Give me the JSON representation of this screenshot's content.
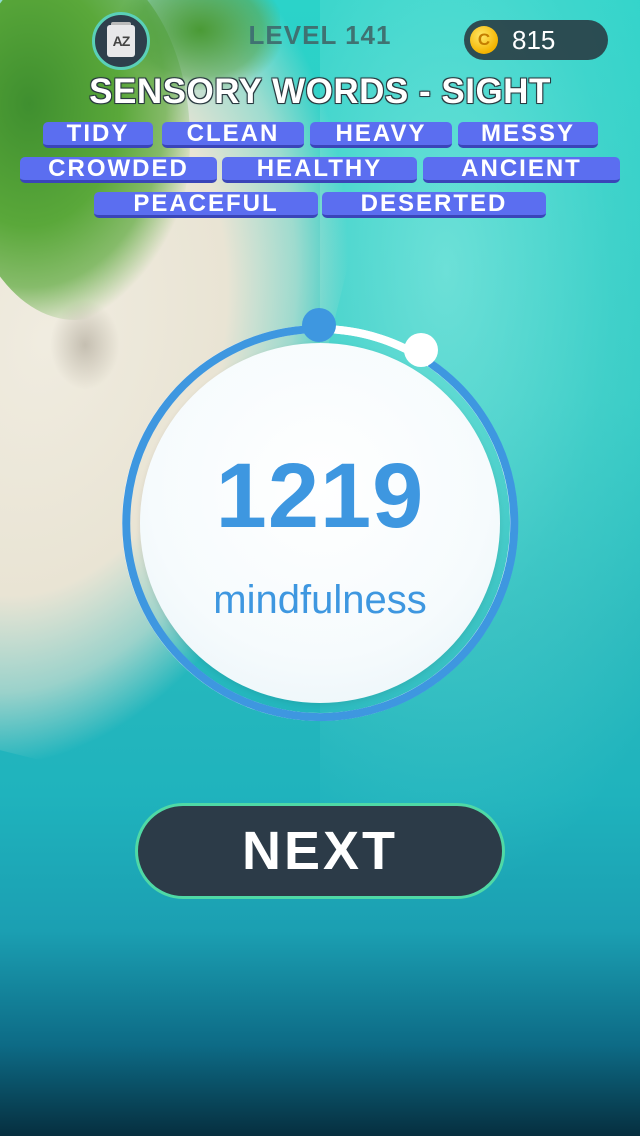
{
  "header": {
    "dictionary_icon_text": "AZ",
    "level_label": "LEVEL 141",
    "coins": "815",
    "coin_symbol": "C"
  },
  "category": "SENSORY WORDS - SIGHT",
  "words": [
    "TIDY",
    "CLEAN",
    "HEAVY",
    "MESSY",
    "CROWDED",
    "HEALTHY",
    "ANCIENT",
    "PEACEFUL",
    "DESERTED"
  ],
  "result": {
    "score": "1219",
    "score_label": "mindfulness"
  },
  "next_label": "NEXT",
  "colors": {
    "chip": "#5b6ef0",
    "score_text": "#3e97e0",
    "button_bg": "#2c3b48",
    "button_border": "#4fd9a6"
  }
}
